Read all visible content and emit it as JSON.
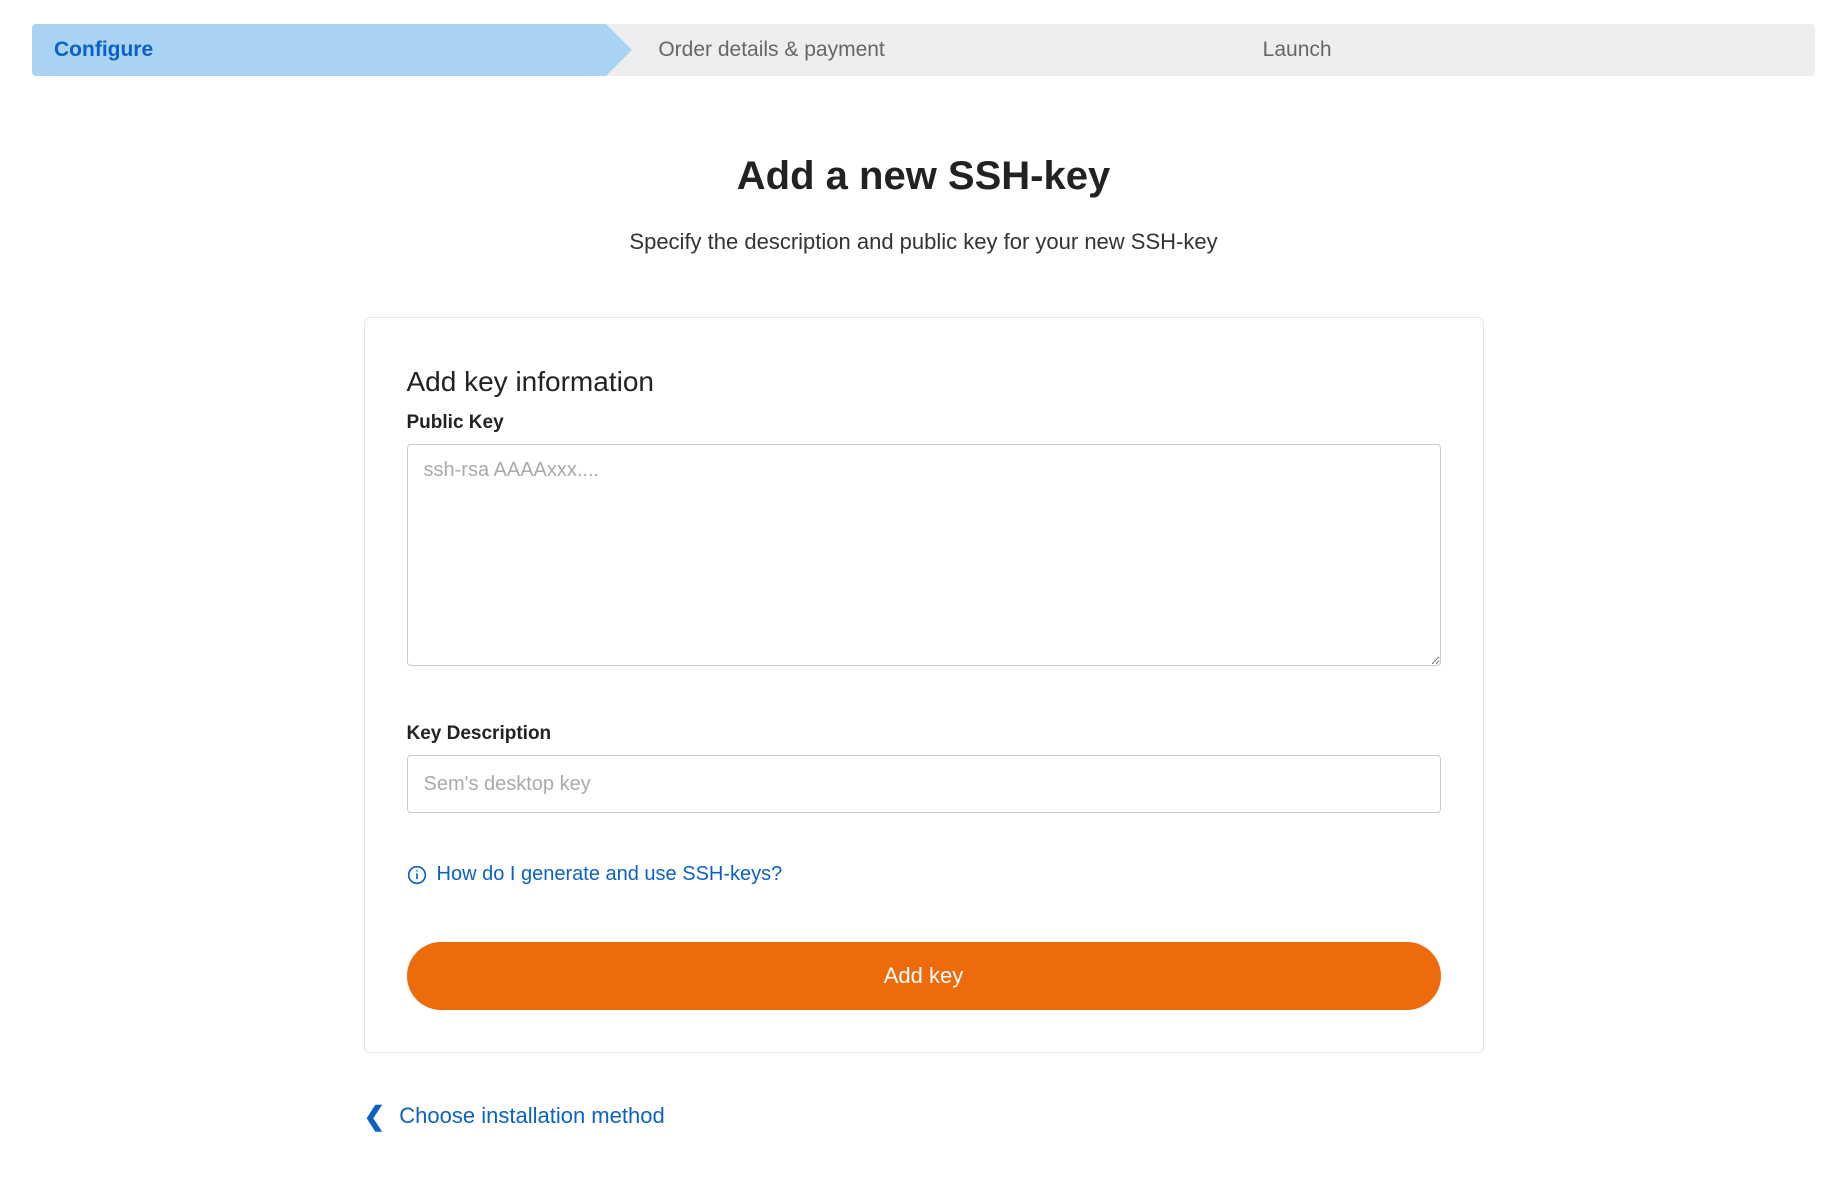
{
  "stepper": {
    "steps": [
      {
        "label": "Configure",
        "active": true
      },
      {
        "label": "Order details & payment",
        "active": false
      },
      {
        "label": "Launch",
        "active": false
      }
    ]
  },
  "page": {
    "title": "Add a new SSH-key",
    "subtitle": "Specify the description and public key for your new SSH-key"
  },
  "form": {
    "section_title": "Add key information",
    "public_key": {
      "label": "Public Key",
      "placeholder": "ssh-rsa AAAAxxx....",
      "value": ""
    },
    "description": {
      "label": "Key Description",
      "placeholder": "Sem's desktop key",
      "value": ""
    },
    "help_link": "How do I generate and use SSH-keys?",
    "submit_label": "Add key"
  },
  "back_link": "Choose installation method",
  "colors": {
    "accent": "#ed6b0b",
    "link": "#0b62c4",
    "step_active_bg": "#a9d3f2"
  }
}
